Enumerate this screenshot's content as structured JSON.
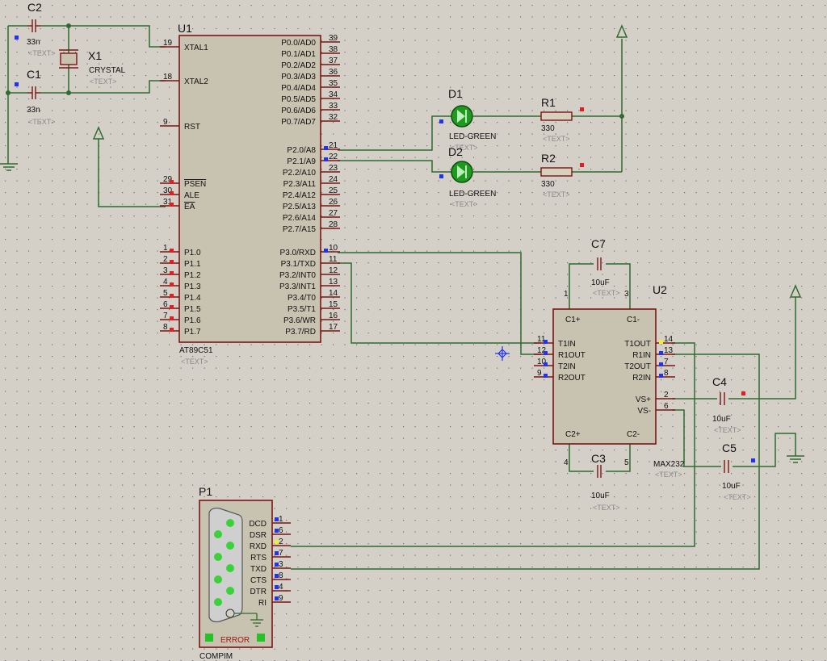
{
  "components": {
    "u1": {
      "ref": "U1",
      "part": "AT89C51",
      "text_tag": "<TEXT>",
      "left_pins": [
        {
          "num": "19",
          "name": "XTAL1"
        },
        {
          "num": "18",
          "name": "XTAL2"
        },
        {
          "num": "9",
          "name": "RST"
        },
        {
          "num": "29",
          "name": "PSEN"
        },
        {
          "num": "30",
          "name": "ALE"
        },
        {
          "num": "31",
          "name": "EA"
        },
        {
          "num": "1",
          "name": "P1.0"
        },
        {
          "num": "2",
          "name": "P1.1"
        },
        {
          "num": "3",
          "name": "P1.2"
        },
        {
          "num": "4",
          "name": "P1.3"
        },
        {
          "num": "5",
          "name": "P1.4"
        },
        {
          "num": "6",
          "name": "P1.5"
        },
        {
          "num": "7",
          "name": "P1.6"
        },
        {
          "num": "8",
          "name": "P1.7"
        }
      ],
      "right_pins": [
        {
          "num": "39",
          "name": "P0.0/AD0"
        },
        {
          "num": "38",
          "name": "P0.1/AD1"
        },
        {
          "num": "37",
          "name": "P0.2/AD2"
        },
        {
          "num": "36",
          "name": "P0.3/AD3"
        },
        {
          "num": "35",
          "name": "P0.4/AD4"
        },
        {
          "num": "34",
          "name": "P0.5/AD5"
        },
        {
          "num": "33",
          "name": "P0.6/AD6"
        },
        {
          "num": "32",
          "name": "P0.7/AD7"
        },
        {
          "num": "21",
          "name": "P2.0/A8"
        },
        {
          "num": "22",
          "name": "P2.1/A9"
        },
        {
          "num": "23",
          "name": "P2.2/A10"
        },
        {
          "num": "24",
          "name": "P2.3/A11"
        },
        {
          "num": "25",
          "name": "P2.4/A12"
        },
        {
          "num": "26",
          "name": "P2.5/A13"
        },
        {
          "num": "27",
          "name": "P2.6/A14"
        },
        {
          "num": "28",
          "name": "P2.7/A15"
        },
        {
          "num": "10",
          "name": "P3.0/RXD"
        },
        {
          "num": "11",
          "name": "P3.1/TXD"
        },
        {
          "num": "12",
          "name": "P3.2/INT0"
        },
        {
          "num": "13",
          "name": "P3.3/INT1"
        },
        {
          "num": "14",
          "name": "P3.4/T0"
        },
        {
          "num": "15",
          "name": "P3.5/T1"
        },
        {
          "num": "16",
          "name": "P3.6/WR"
        },
        {
          "num": "17",
          "name": "P3.7/RD"
        }
      ]
    },
    "u2": {
      "ref": "U2",
      "part": "MAX232",
      "text_tag": "<TEXT>",
      "left_pins": [
        {
          "num": "11",
          "name": "T1IN"
        },
        {
          "num": "12",
          "name": "R1OUT"
        },
        {
          "num": "10",
          "name": "T2IN"
        },
        {
          "num": "9",
          "name": "R2OUT"
        }
      ],
      "right_pins": [
        {
          "num": "14",
          "name": "T1OUT"
        },
        {
          "num": "13",
          "name": "R1IN"
        },
        {
          "num": "7",
          "name": "T2OUT"
        },
        {
          "num": "8",
          "name": "R2IN"
        }
      ],
      "power_pins": [
        {
          "num": "2",
          "name": "VS+"
        },
        {
          "num": "6",
          "name": "VS-"
        }
      ],
      "cap_pins": [
        {
          "num": "1",
          "name": "C1+"
        },
        {
          "num": "3",
          "name": "C1-"
        },
        {
          "num": "4",
          "name": "C2+"
        },
        {
          "num": "5",
          "name": "C2-"
        }
      ]
    },
    "c1": {
      "ref": "C1",
      "value": "33n",
      "text_tag": "<TEXT>"
    },
    "c2": {
      "ref": "C2",
      "value": "33n",
      "text_tag": "<TEXT>"
    },
    "x1": {
      "ref": "X1",
      "value": "CRYSTAL",
      "text_tag": "<TEXT>"
    },
    "d1": {
      "ref": "D1",
      "value": "LED-GREEN",
      "text_tag": "<TEXT>"
    },
    "d2": {
      "ref": "D2",
      "value": "LED-GREEN",
      "text_tag": "<TEXT>"
    },
    "r1": {
      "ref": "R1",
      "value": "330",
      "text_tag": "<TEXT>"
    },
    "r2": {
      "ref": "R2",
      "value": "330",
      "text_tag": "<TEXT>"
    },
    "c3": {
      "ref": "C3",
      "value": "10uF",
      "text_tag": "<TEXT>"
    },
    "c4": {
      "ref": "C4",
      "value": "10uF",
      "text_tag": "<TEXT>"
    },
    "c5": {
      "ref": "C5",
      "value": "10uF",
      "text_tag": "<TEXT>"
    },
    "c7": {
      "ref": "C7",
      "value": "10uF",
      "text_tag": "<TEXT>"
    },
    "p1": {
      "ref": "P1",
      "part": "COMPIM",
      "status": "ERROR",
      "pins": [
        {
          "num": "1",
          "name": "DCD"
        },
        {
          "num": "6",
          "name": "DSR"
        },
        {
          "num": "2",
          "name": "RXD"
        },
        {
          "num": "7",
          "name": "RTS"
        },
        {
          "num": "3",
          "name": "TXD"
        },
        {
          "num": "8",
          "name": "CTS"
        },
        {
          "num": "4",
          "name": "DTR"
        },
        {
          "num": "9",
          "name": "RI"
        }
      ]
    }
  },
  "colors": {
    "background": "#d4d0c8",
    "grid_dot": "#6e6e6e",
    "wire": "#2f6b2f",
    "outline": "#7a1515",
    "chip_fill": "#c8c2b0",
    "led": "#1f9a1f",
    "pin_marker_blue": "#2233ee",
    "pin_marker_red": "#e02020",
    "pin_marker_yellow": "#eeee33"
  }
}
